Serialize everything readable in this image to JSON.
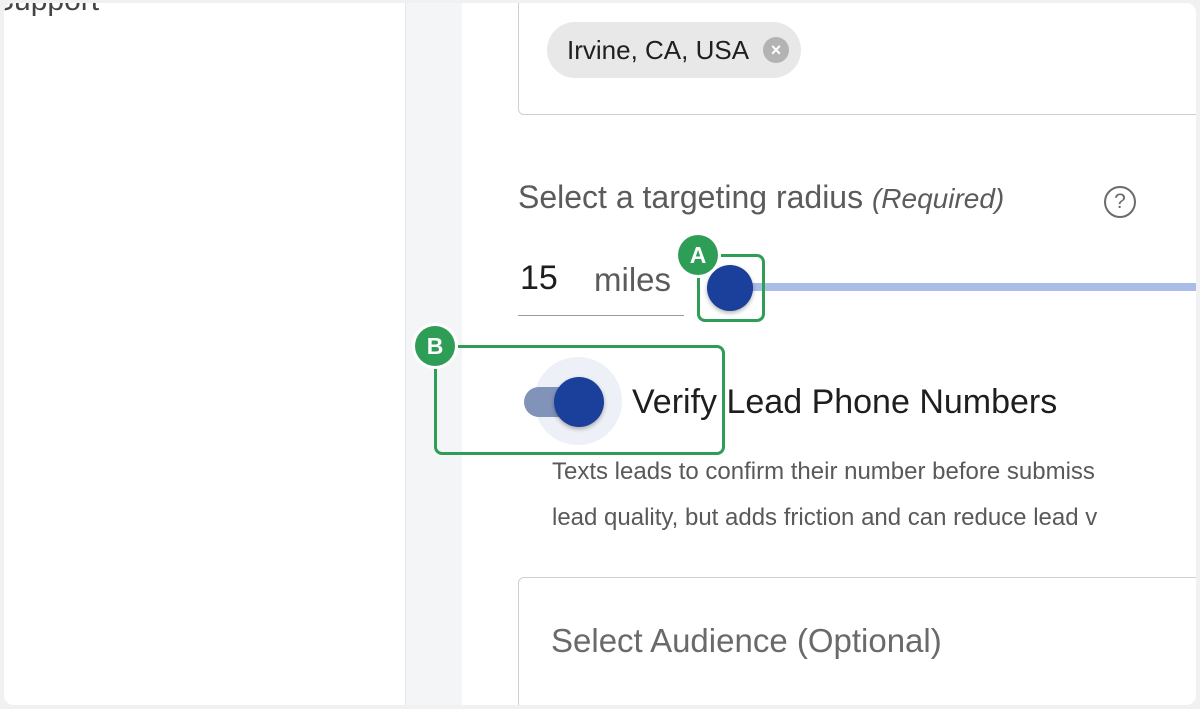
{
  "sidebar": {
    "items": [
      {
        "label": "Support",
        "icon": "chevron-down-icon"
      }
    ]
  },
  "location": {
    "chips": [
      {
        "label": "Irvine, CA, USA",
        "remove_icon": "close-circle-icon"
      }
    ]
  },
  "radius": {
    "label": "Select a targeting radius",
    "required": "(Required)",
    "help_icon": "?",
    "value": "15",
    "unit": "miles",
    "slider_fraction": 0.0
  },
  "verify": {
    "label": "Verify Lead Phone Numbers",
    "checked": true,
    "help_line1": "Texts leads to confirm their number before submiss",
    "help_line2": "lead quality, but adds friction and can reduce lead v"
  },
  "audience": {
    "placeholder": "Select Audience (Optional)"
  },
  "markers": [
    {
      "label": "A"
    },
    {
      "label": "B"
    }
  ],
  "colors": {
    "accent": "#1b409b",
    "slider_track": "#a9bde6",
    "toggle_track": "#8293ba",
    "marker": "#2e9e57"
  }
}
